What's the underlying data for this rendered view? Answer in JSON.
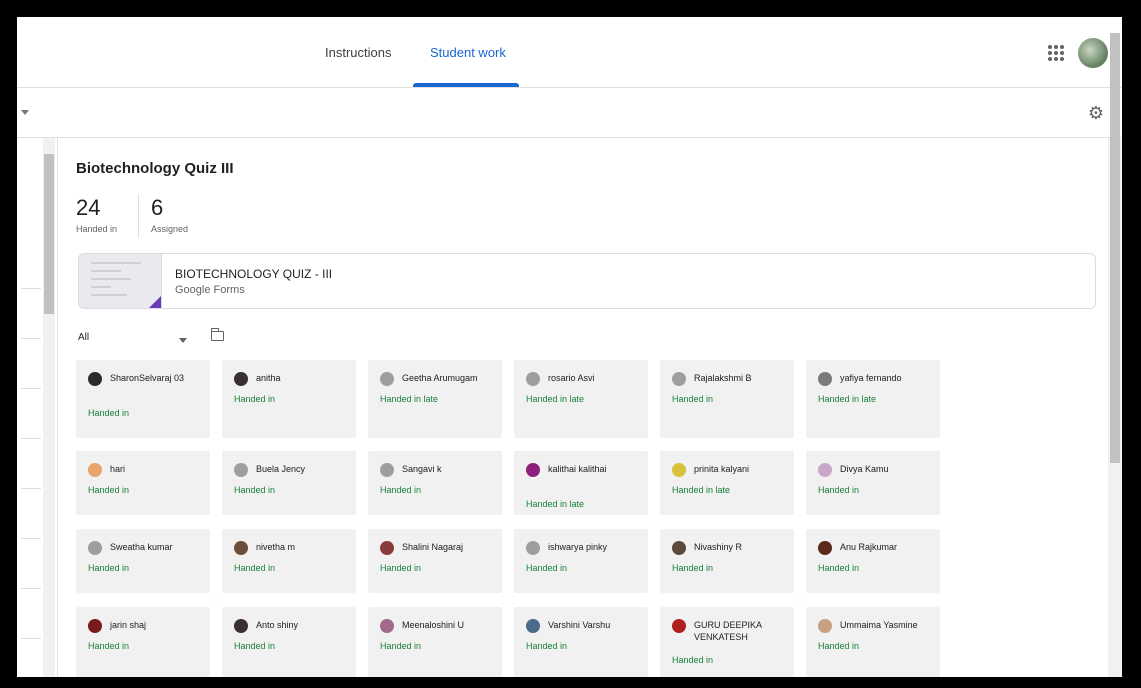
{
  "tabs": [
    {
      "label": "Instructions"
    },
    {
      "label": "Student work"
    }
  ],
  "assignment": {
    "title": "Biotechnology Quiz III",
    "handed_in_count": "24",
    "handed_in_label": "Handed in",
    "assigned_count": "6",
    "assigned_label": "Assigned",
    "attachment_title": "BIOTECHNOLOGY QUIZ - III",
    "attachment_type": "Google Forms"
  },
  "filter": {
    "label": "All"
  },
  "students": [
    {
      "name": "SharonSelvaraj 03",
      "status": "Handed in",
      "avatar_color": "#2b2b2b"
    },
    {
      "name": "anitha",
      "status": "Handed in",
      "avatar_color": "#3a2f35"
    },
    {
      "name": "Geetha Arumugam",
      "status": "Handed in late",
      "avatar_color": "#9e9e9e"
    },
    {
      "name": "rosario Asvi",
      "status": "Handed in late",
      "avatar_color": "#9e9e9e"
    },
    {
      "name": "Rajalakshmi B",
      "status": "Handed in",
      "avatar_color": "#9e9e9e"
    },
    {
      "name": "yafiya fernando",
      "status": "Handed in late",
      "avatar_color": "#7a7a7a"
    },
    {
      "name": "hari",
      "status": "Handed in",
      "avatar_color": "#e8a46a"
    },
    {
      "name": "Buela Jency",
      "status": "Handed in",
      "avatar_color": "#9e9e9e"
    },
    {
      "name": "Sangavi k",
      "status": "Handed in",
      "avatar_color": "#9e9e9e"
    },
    {
      "name": "kalithai kalithai",
      "status": "Handed in late",
      "avatar_color": "#8e1f7a"
    },
    {
      "name": "prinita kalyani",
      "status": "Handed in late",
      "avatar_color": "#d9c23a"
    },
    {
      "name": "Divya Kamu",
      "status": "Handed in",
      "avatar_color": "#c9a7c9"
    },
    {
      "name": "Sweatha kumar",
      "status": "Handed in",
      "avatar_color": "#9e9e9e"
    },
    {
      "name": "nivetha m",
      "status": "Handed in",
      "avatar_color": "#6b4f3a"
    },
    {
      "name": "Shalini Nagaraj",
      "status": "Handed in",
      "avatar_color": "#8a3b3b"
    },
    {
      "name": "ishwarya pinky",
      "status": "Handed in",
      "avatar_color": "#9e9e9e"
    },
    {
      "name": "Nivashiny R",
      "status": "Handed in",
      "avatar_color": "#5a4a3a"
    },
    {
      "name": "Anu Rajkumar",
      "status": "Handed in",
      "avatar_color": "#5a2a1a"
    },
    {
      "name": "jarin shaj",
      "status": "Handed in",
      "avatar_color": "#7a1a1a"
    },
    {
      "name": "Anto shiny",
      "status": "Handed in",
      "avatar_color": "#3a3030"
    },
    {
      "name": "Meenaloshini U",
      "status": "Handed in",
      "avatar_color": "#a06a8a"
    },
    {
      "name": "Varshini Varshu",
      "status": "Handed in",
      "avatar_color": "#4a6a8a"
    },
    {
      "name": "GURU DEEPIKA VENKATESH",
      "status": "Handed in",
      "avatar_color": "#b02020"
    },
    {
      "name": "Ummaima Yasmine",
      "status": "Handed in",
      "avatar_color": "#c8a080"
    }
  ]
}
